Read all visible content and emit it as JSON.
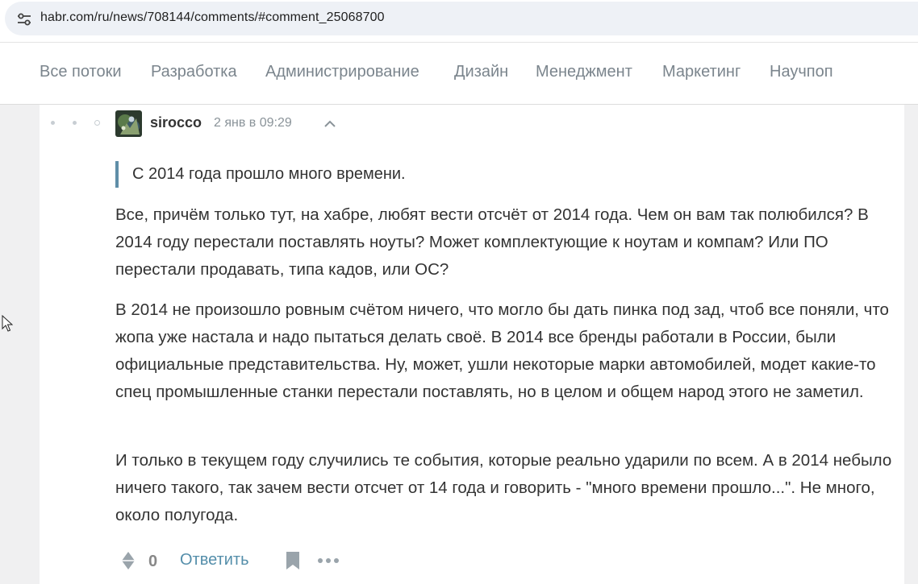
{
  "address_bar": {
    "url": "habr.com/ru/news/708144/comments/#comment_25068700",
    "icon": "tune-icon"
  },
  "nav": {
    "items": [
      {
        "label": "Все потоки"
      },
      {
        "label": "Разработка"
      },
      {
        "label": "Администрирование"
      },
      {
        "label": "Дизайн"
      },
      {
        "label": "Менеджмент"
      },
      {
        "label": "Маркетинг"
      },
      {
        "label": "Научпоп"
      }
    ]
  },
  "comment": {
    "author": "sirocco",
    "timestamp": "2 янв в 09:29",
    "quote": "С 2014 года прошло много времени.",
    "paragraphs": [
      "Все, причём только тут, на хабре, любят вести отсчёт от 2014 года. Чем он вам так полюбился? В 2014 году перестали поставлять ноуты? Может комплектующие к ноутам и компам? Или ПО перестали продавать, типа кадов, или ОС?",
      "В 2014 не произошло ровным счётом ничего, что могло бы дать пинка под зад, чтоб все поняли, что жопа уже настала и надо пытаться делать своё. В 2014 все бренды работали в России, были официальные представительства. Ну, может, ушли некоторые марки автомобилей, модет какие-то спец промышленные станки перестали поставлять, но в целом и общем народ этого не заметил.",
      "И только в текущем году случились те события, которые реально ударили по всем. А в 2014 небыло ничего такого, так зачем вести отсчет от 14 года и говорить - \"много времени прошло...\". Не много, около полугода."
    ],
    "score": "0",
    "reply_label": "Ответить"
  },
  "colors": {
    "accent_link": "#548eaa",
    "quote_bar": "#5f8ea8",
    "nav_text": "#7b858d",
    "page_bg": "#f0f0f1"
  }
}
